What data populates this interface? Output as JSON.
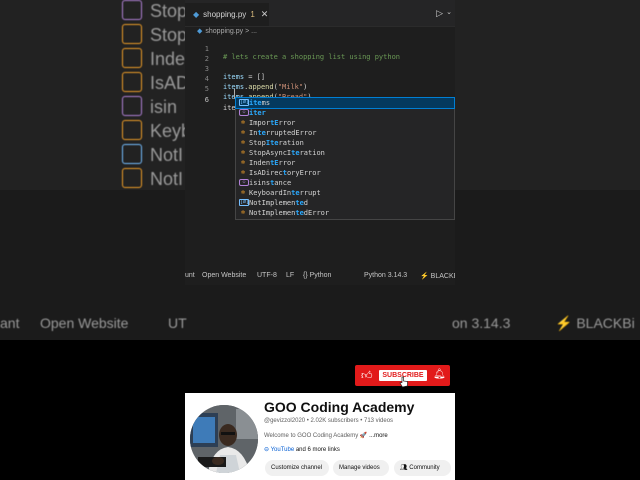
{
  "background": {
    "ghost_items": [
      "Stop",
      "Stop",
      "Inde",
      "IsAD",
      "isin",
      "Keyb",
      "NotI",
      "NotI"
    ],
    "status_items": [
      "ant",
      "Open Website",
      "UT",
      "on 3.14.3",
      "⚡ BLACKBi"
    ]
  },
  "editor": {
    "tab": {
      "filename": "shopping.py",
      "modified_count": "1",
      "close_glyph": "✕"
    },
    "breadcrumb": {
      "file": "shopping.py",
      "separator": ">",
      "rest": "..."
    },
    "lines": [
      {
        "n": "1",
        "comment": "# lets create a shopping list using python"
      },
      {
        "n": "2"
      },
      {
        "n": "3",
        "var": "items",
        "rest": " = []"
      },
      {
        "n": "4",
        "var": "items",
        "dot": ".",
        "fn": "append",
        "open": "(",
        "str": "\"Milk\"",
        "close": ")"
      },
      {
        "n": "5",
        "var": "items",
        "dot": ".",
        "fn": "append",
        "open": "(",
        "str": "\"Bread\"",
        "close": ")"
      },
      {
        "n": "6",
        "typed": "ite"
      }
    ],
    "suggestions": [
      {
        "kind": "var",
        "hl": "ite",
        "rest": "ms",
        "pre": ""
      },
      {
        "kind": "fn",
        "hl": "iter",
        "rest": "",
        "pre": ""
      },
      {
        "kind": "cls",
        "pre": "Impor",
        "hl": "tE",
        "rest": "rror"
      },
      {
        "kind": "cls",
        "pre": "In",
        "hl": "te",
        "rest": "rruptedError"
      },
      {
        "kind": "cls",
        "pre": "Stop",
        "hl": "Ite",
        "rest": "ration"
      },
      {
        "kind": "cls",
        "pre": "StopAsyncI",
        "hl": "te",
        "rest": "ration"
      },
      {
        "kind": "cls",
        "pre": "Inden",
        "hl": "tE",
        "rest": "rror"
      },
      {
        "kind": "cls",
        "pre": "IsADirec",
        "hl": "t",
        "rest": "oryError"
      },
      {
        "kind": "fn",
        "pre": "isins",
        "hl": "t",
        "rest": "ance"
      },
      {
        "kind": "cls",
        "pre": "KeyboardIn",
        "hl": "te",
        "rest": "rrupt"
      },
      {
        "kind": "var",
        "pre": "NotImplemen",
        "hl": "te",
        "rest": "d"
      },
      {
        "kind": "cls",
        "pre": "NotImplemen",
        "hl": "te",
        "rest": "dError"
      }
    ]
  },
  "statusbar": {
    "items": [
      "unt",
      "Open Website",
      "UTF-8",
      "LF",
      "{} Python",
      "Python 3.14.3",
      "⚡ BLACKB"
    ]
  },
  "subscribe": {
    "label": "SUBSCRIBE"
  },
  "channel": {
    "name": "GOO Coding Academy",
    "meta": "@gevizzol2020 • 2.02K subscribers • 713 videos",
    "description": "Welcome to GOO Coding Academy 🚀",
    "more": "...more",
    "link_label": "YouTube",
    "link_rest": " and 6 more links",
    "buttons": [
      "Customize channel",
      "Manage videos",
      "Community"
    ]
  },
  "colors": {
    "subscribe_red": "#e21a1a",
    "editor_bg": "#1e1e1e",
    "selection": "#04395e",
    "match_highlight": "#2aaaff"
  }
}
